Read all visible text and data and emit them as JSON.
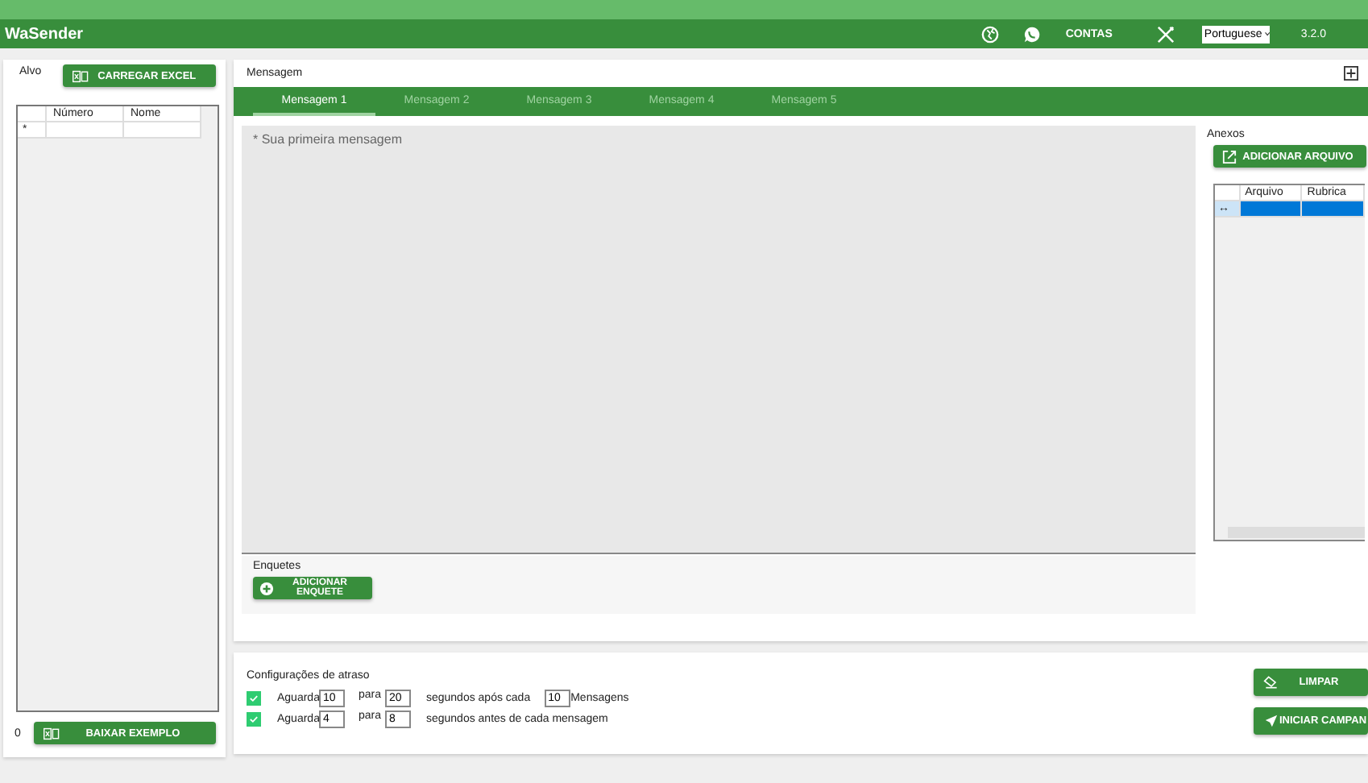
{
  "app": {
    "title": "WaSender",
    "accounts_label": "CONTAS",
    "language": "Portuguese",
    "version": "3.2.0"
  },
  "target": {
    "label": "Alvo",
    "load_button": "CARREGAR EXCEL",
    "columns": [
      "Número",
      "Nome"
    ],
    "new_row_marker": "*",
    "count": "0",
    "example_button": "BAIXAR EXEMPLO"
  },
  "message": {
    "title": "Mensagem",
    "tabs": [
      {
        "label": "Mensagem 1",
        "selected": true
      },
      {
        "label": "Mensagem 2",
        "selected": false
      },
      {
        "label": "Mensagem 3",
        "selected": false
      },
      {
        "label": "Mensagem 4",
        "selected": false
      },
      {
        "label": "Mensagem 5",
        "selected": false
      }
    ],
    "placeholder": "* Sua primeira mensagem",
    "polls": {
      "label": "Enquetes",
      "add_button": "ADICIONAR ENQUETE"
    },
    "attachments": {
      "label": "Anexos",
      "add_button": "ADICIONAR ARQUIVO",
      "columns": [
        "Arquivo",
        "Rubrica"
      ],
      "rows": [
        {
          "marker": "↔",
          "selected": true
        }
      ]
    }
  },
  "delay": {
    "title": "Configurações de atraso",
    "rules": [
      {
        "checked": true,
        "wait_label": "Aguarda",
        "from": "10",
        "to_label": "para",
        "to": "20",
        "text": "segundos após cada",
        "count": "10",
        "unit": "Mensagens"
      },
      {
        "checked": true,
        "wait_label": "Aguarda",
        "from": "4",
        "to_label": "para",
        "to": "8",
        "text": "segundos antes de cada mensagem"
      }
    ]
  },
  "actions": {
    "clear_button": "LIMPAR",
    "start_button": "INICIAR CAMPAN"
  }
}
